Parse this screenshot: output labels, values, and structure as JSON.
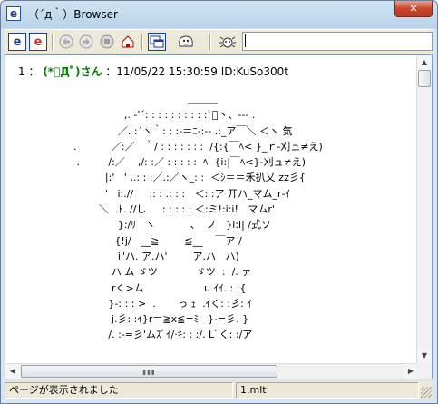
{
  "window": {
    "title": "（´д｀）Browser",
    "close_glyph": "✕",
    "app_icon_glyph": "e"
  },
  "toolbar": {
    "buttons": [
      {
        "name": "new-window-button",
        "icon": "e-icon",
        "glyph": "e"
      },
      {
        "name": "open-button",
        "icon": "e-red-icon",
        "glyph": "e"
      },
      {
        "name": "back-button",
        "icon": "back-icon"
      },
      {
        "name": "forward-button",
        "icon": "forward-icon"
      },
      {
        "name": "stop-button",
        "icon": "stop-icon"
      },
      {
        "name": "home-button",
        "icon": "home-icon"
      },
      {
        "name": "windows-button",
        "icon": "windows-icon"
      },
      {
        "name": "monster-button",
        "icon": "monster-icon"
      },
      {
        "name": "settings-button",
        "icon": "bug-icon"
      }
    ],
    "url_value": ""
  },
  "post": {
    "number": "1",
    "separator": "：",
    "name": "(*ﾟДﾟ)さん",
    "meta": "：11/05/22 15:30:59 ID:KuSo300t",
    "aa_lines": [
      "                                              ＿＿＿",
      "                          ,. ‐'´: : : : : : : : : :`ﾞ丶、‐‐- .",
      "                        ／. :´ヽ｀: : :‐＝ﾆ‐:‐- .:_ア￣＼ ＜ヽ 気",
      "          .           ／:／   ｀/ : : : : : : :  /{:{￣ﾍ< }_ｒ‐刈ュ≠え)",
      "           .         /:／    ,/: :／ : : : : :  ﾍ  {i:|￣ﾍ<}‐刈ュ≠え)",
      "                    |:'   ' ,.: : :／.:／ヽ_: :  ＜ｼ＝＝禾扒乂|zz彡{",
      "                    '   i:.//     ,: : .: : :   ＜: :ア 丌ハ_マム_r‐ｲ",
      "                  ＼  .ﾄ. //し     : : : : : ＜:ミ!:i:i!   マムr'",
      "                        }:/ﾘ   ヽ           、  ノ   }i:i| /式ソ",
      "                       {!j/   __≧        ≦__    ￣ア /",
      "                        i\"ハ. ア.ハ'        ア.ハ   ハ)",
      "                      ハ ム ゞツ            ゞツ  :  /. ァ",
      "                      rく>ム                   u ｲｲ. : :{",
      "                     }‐: : : >  .       っ ｪ  .ｲく: :彡: ｲ",
      "                      j.彡: :ｲ}r＝≧x≦=ﾐ'  }‐=彡. }",
      "                     /. :‐=彡'ムｽﾞｲ/·ｷ: : :/. Lﾞく: :/ア"
    ]
  },
  "status": {
    "message": "ページが表示されました",
    "file": "1.mlt"
  },
  "scroll": {
    "vertical_position": 0.0,
    "horizontal_position": 0.0
  }
}
